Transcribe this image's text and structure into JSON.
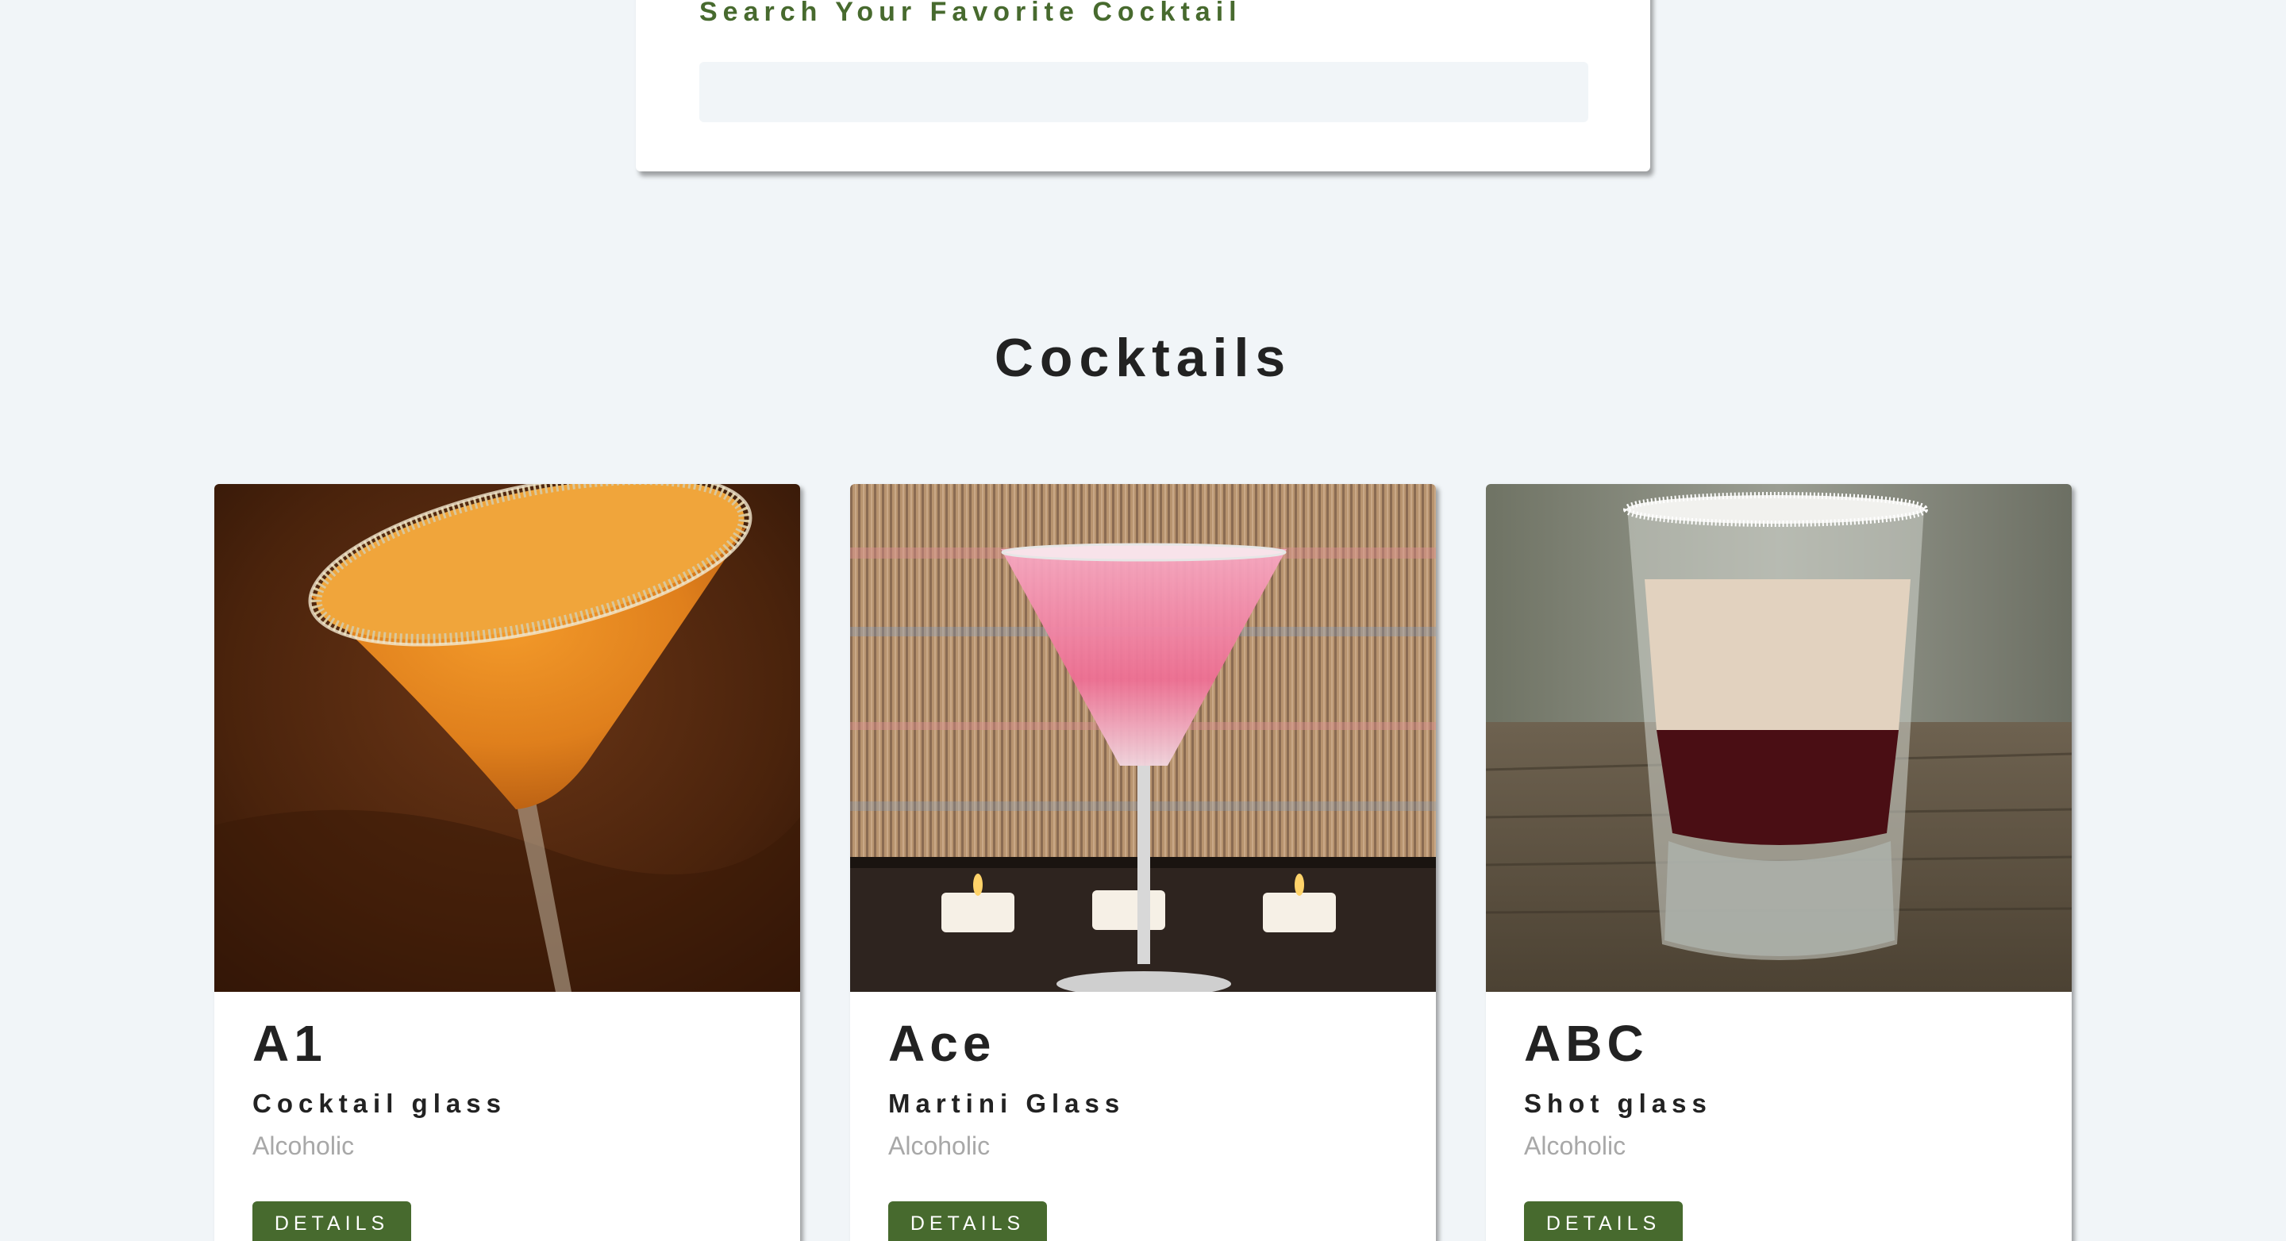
{
  "search": {
    "label": "Search Your Favorite Cocktail",
    "value": ""
  },
  "section": {
    "title": "Cocktails"
  },
  "cocktails": [
    {
      "name": "A1",
      "glass": "Cocktail glass",
      "type": "Alcoholic",
      "button_label": "DETAILS",
      "image_icon": "orange-martini-photo"
    },
    {
      "name": "Ace",
      "glass": "Martini Glass",
      "type": "Alcoholic",
      "button_label": "DETAILS",
      "image_icon": "pink-martini-photo"
    },
    {
      "name": "ABC",
      "glass": "Shot glass",
      "type": "Alcoholic",
      "button_label": "DETAILS",
      "image_icon": "layered-shot-photo"
    }
  ],
  "colors": {
    "accent": "#476a2e",
    "background": "#f1f5f8",
    "card": "#ffffff",
    "muted_text": "#a8a8a8"
  }
}
